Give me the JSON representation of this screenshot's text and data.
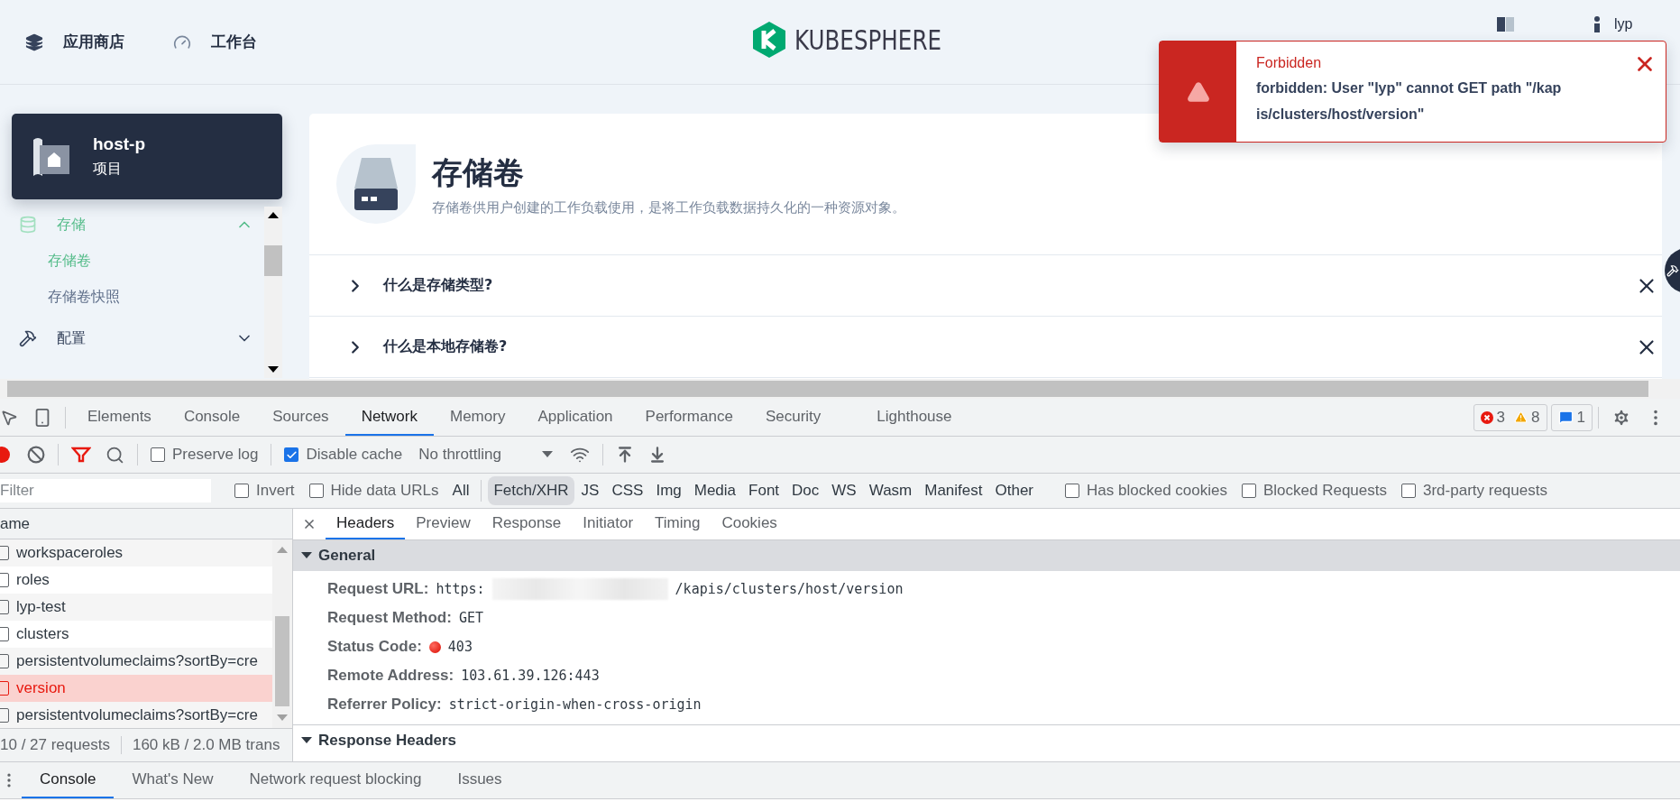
{
  "app": {
    "nav": [
      {
        "label": "应用商店",
        "kind": "store"
      },
      {
        "label": "工作台",
        "kind": "workbench"
      }
    ],
    "logo": "KUBESPHERE",
    "user": "lyp",
    "project": {
      "name": "host-p",
      "type": "项目"
    },
    "sidebar": [
      {
        "label": "存储",
        "kind": "storage",
        "expanded": true,
        "children": [
          {
            "label": "存储卷",
            "selected": true
          },
          {
            "label": "存储卷快照",
            "selected": false
          }
        ]
      },
      {
        "label": "配置",
        "kind": "config",
        "expanded": false
      }
    ],
    "page": {
      "title": "存储卷",
      "description": "存储卷供用户创建的工作负载使用，是将工作负载数据持久化的一种资源对象。"
    },
    "faq": [
      {
        "question": "什么是存储类型?"
      },
      {
        "question": "什么是本地存储卷?"
      }
    ]
  },
  "toast": {
    "title": "Forbidden",
    "message": "forbidden: User \"lyp\" cannot GET path \"/kapis/clusters/host/version\""
  },
  "devtools": {
    "tabs": [
      {
        "label": "Elements",
        "selected": false
      },
      {
        "label": "Console",
        "selected": false
      },
      {
        "label": "Sources",
        "selected": false
      },
      {
        "label": "Network",
        "selected": true
      },
      {
        "label": "Memory",
        "selected": false
      },
      {
        "label": "Application",
        "selected": false
      },
      {
        "label": "Performance",
        "selected": false
      },
      {
        "label": "Security",
        "selected": false
      },
      {
        "label": "Lighthouse",
        "selected": false
      }
    ],
    "errors": "3",
    "warnings": "8",
    "messages": "1",
    "toolbar": {
      "options": [
        {
          "label": "Preserve log",
          "checked": false
        },
        {
          "label": "Disable cache",
          "checked": true
        }
      ],
      "throttling": "No throttling"
    },
    "filter": {
      "placeholder": "Filter",
      "before": [
        {
          "label": "Invert",
          "checked": false
        },
        {
          "label": "Hide data URLs",
          "checked": false
        }
      ],
      "types": [
        {
          "label": "All",
          "selected": false
        },
        {
          "label": "Fetch/XHR",
          "selected": true
        },
        {
          "label": "JS",
          "selected": false
        },
        {
          "label": "CSS",
          "selected": false
        },
        {
          "label": "Img",
          "selected": false
        },
        {
          "label": "Media",
          "selected": false
        },
        {
          "label": "Font",
          "selected": false
        },
        {
          "label": "Doc",
          "selected": false
        },
        {
          "label": "WS",
          "selected": false
        },
        {
          "label": "Wasm",
          "selected": false
        },
        {
          "label": "Manifest",
          "selected": false
        },
        {
          "label": "Other",
          "selected": false
        }
      ],
      "after": [
        {
          "label": "Has blocked cookies",
          "checked": false
        },
        {
          "label": "Blocked Requests",
          "checked": false
        },
        {
          "label": "3rd-party requests",
          "checked": false
        }
      ]
    },
    "requests": {
      "header": "ame",
      "rows": [
        {
          "name": "workspaceroles",
          "selected": false,
          "error": false
        },
        {
          "name": "roles",
          "selected": false,
          "error": false
        },
        {
          "name": "lyp-test",
          "selected": false,
          "error": false
        },
        {
          "name": "clusters",
          "selected": false,
          "error": false
        },
        {
          "name": "persistentvolumeclaims?sortBy=cre",
          "selected": false,
          "error": false
        },
        {
          "name": "version",
          "selected": true,
          "error": true
        },
        {
          "name": "persistentvolumeclaims?sortBy=cre",
          "selected": false,
          "error": false
        }
      ],
      "summary": [
        "10 / 27 requests",
        "160 kB / 2.0 MB trans"
      ]
    },
    "detail_tabs": [
      {
        "label": "Headers",
        "selected": true
      },
      {
        "label": "Preview",
        "selected": false
      },
      {
        "label": "Response",
        "selected": false
      },
      {
        "label": "Initiator",
        "selected": false
      },
      {
        "label": "Timing",
        "selected": false
      },
      {
        "label": "Cookies",
        "selected": false
      }
    ],
    "general": {
      "title": "General",
      "expanded": true,
      "fields": [
        {
          "label": "Request URL:",
          "kind": "url",
          "value": "https:",
          "value_end": "/kapis/clusters/host/version"
        },
        {
          "label": "Request Method:",
          "kind": "text",
          "value": "GET"
        },
        {
          "label": "Status Code:",
          "kind": "status",
          "value": "403"
        },
        {
          "label": "Remote Address:",
          "kind": "text",
          "value": "103.61.39.126:443"
        },
        {
          "label": "Referrer Policy:",
          "kind": "text",
          "value": "strict-origin-when-cross-origin"
        }
      ]
    },
    "response_headers": {
      "title": "Response Headers",
      "expanded": true
    },
    "drawer_tabs": [
      {
        "label": "Console",
        "selected": true
      },
      {
        "label": "What's New",
        "selected": false
      },
      {
        "label": "Network request blocking",
        "selected": false
      },
      {
        "label": "Issues",
        "selected": false
      }
    ]
  }
}
